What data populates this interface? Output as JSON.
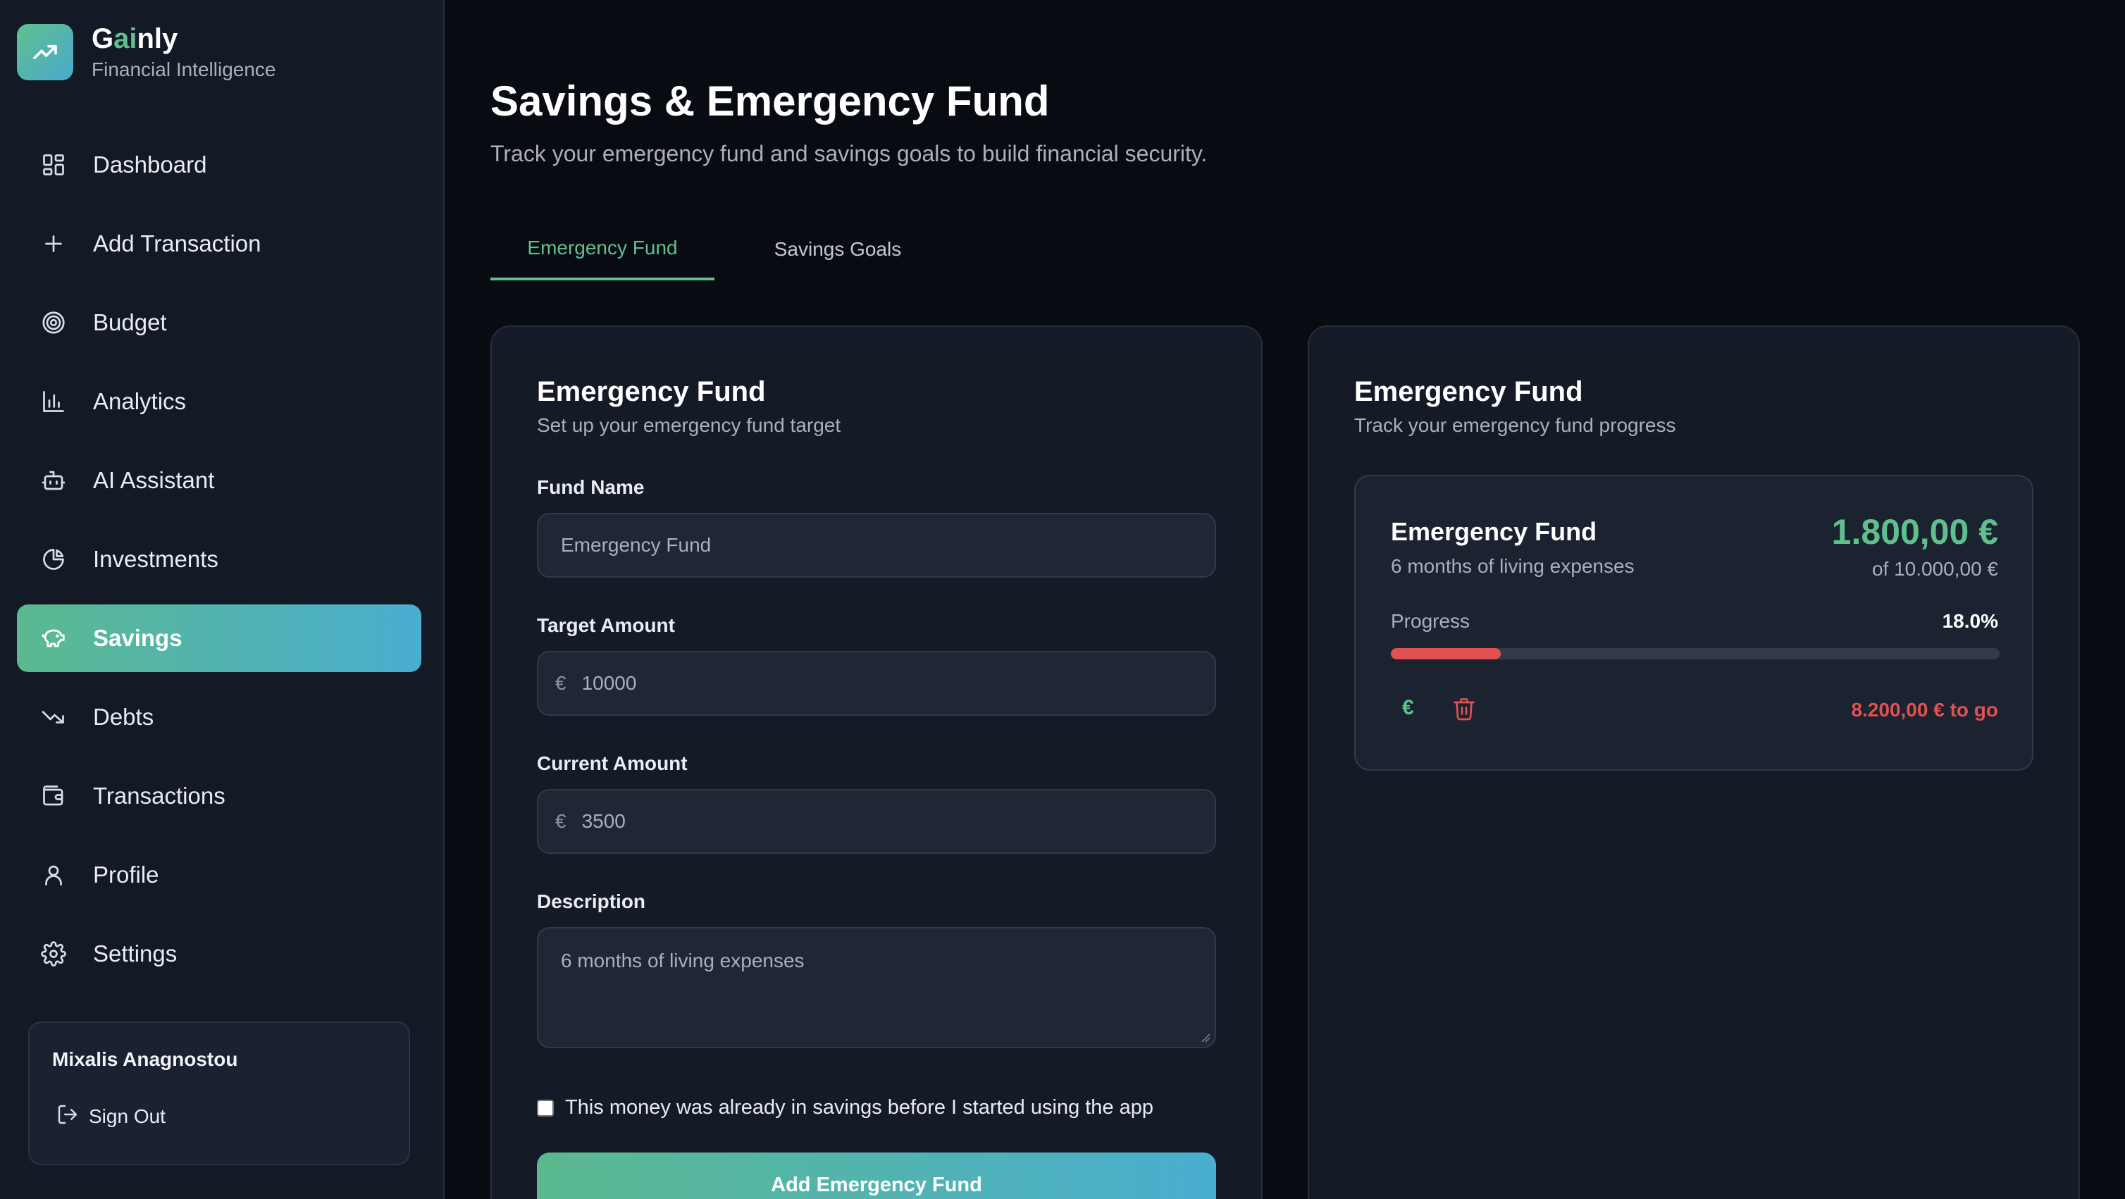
{
  "brand": {
    "name_prefix": "G",
    "name_accent": "ai",
    "name_suffix": "nly",
    "tagline": "Financial Intelligence",
    "logo_icon": "trending-up-icon"
  },
  "sidebar": {
    "items": [
      {
        "label": "Dashboard",
        "icon": "dashboard-icon"
      },
      {
        "label": "Add Transaction",
        "icon": "plus-icon"
      },
      {
        "label": "Budget",
        "icon": "target-icon"
      },
      {
        "label": "Analytics",
        "icon": "bar-chart-icon"
      },
      {
        "label": "AI Assistant",
        "icon": "robot-icon"
      },
      {
        "label": "Investments",
        "icon": "pie-chart-icon"
      },
      {
        "label": "Savings",
        "icon": "piggy-bank-icon",
        "active": true
      },
      {
        "label": "Debts",
        "icon": "trending-down-icon"
      },
      {
        "label": "Transactions",
        "icon": "wallet-icon"
      },
      {
        "label": "Profile",
        "icon": "user-icon"
      },
      {
        "label": "Settings",
        "icon": "gear-icon"
      }
    ],
    "user_name": "Mixalis Anagnostou",
    "signout_label": "Sign Out"
  },
  "header": {
    "title": "Savings & Emergency Fund",
    "subtitle": "Track your emergency fund and savings goals to build financial security."
  },
  "tabs": [
    {
      "label": "Emergency Fund",
      "active": true
    },
    {
      "label": "Savings Goals",
      "active": false
    }
  ],
  "form": {
    "title": "Emergency Fund",
    "subtitle": "Set up your emergency fund target",
    "fund_name_label": "Fund Name",
    "fund_name_value": "Emergency Fund",
    "target_label": "Target Amount",
    "target_currency": "€",
    "target_value": "10000",
    "current_label": "Current Amount",
    "current_currency": "€",
    "current_value": "3500",
    "description_label": "Description",
    "description_value": "6 months of living expenses",
    "checkbox_label": "This money was already in savings before I started using the app",
    "checkbox_checked": false,
    "submit_label": "Add Emergency Fund"
  },
  "progress_panel": {
    "title": "Emergency Fund",
    "subtitle": "Track your emergency fund progress",
    "fund": {
      "name": "Emergency Fund",
      "description": "6 months of living expenses",
      "amount": "1.800,00 €",
      "of_target": "of 10.000,00 €",
      "progress_label": "Progress",
      "progress_pct_text": "18.0%",
      "progress_fraction": 0.18,
      "euro_action": "€",
      "remaining": "8.200,00 € to go"
    }
  },
  "colors": {
    "accent_green": "#5fc08e",
    "accent_blue": "#4aaed0",
    "danger_red": "#e05252",
    "background": "#080b12",
    "panel": "#141a26"
  }
}
